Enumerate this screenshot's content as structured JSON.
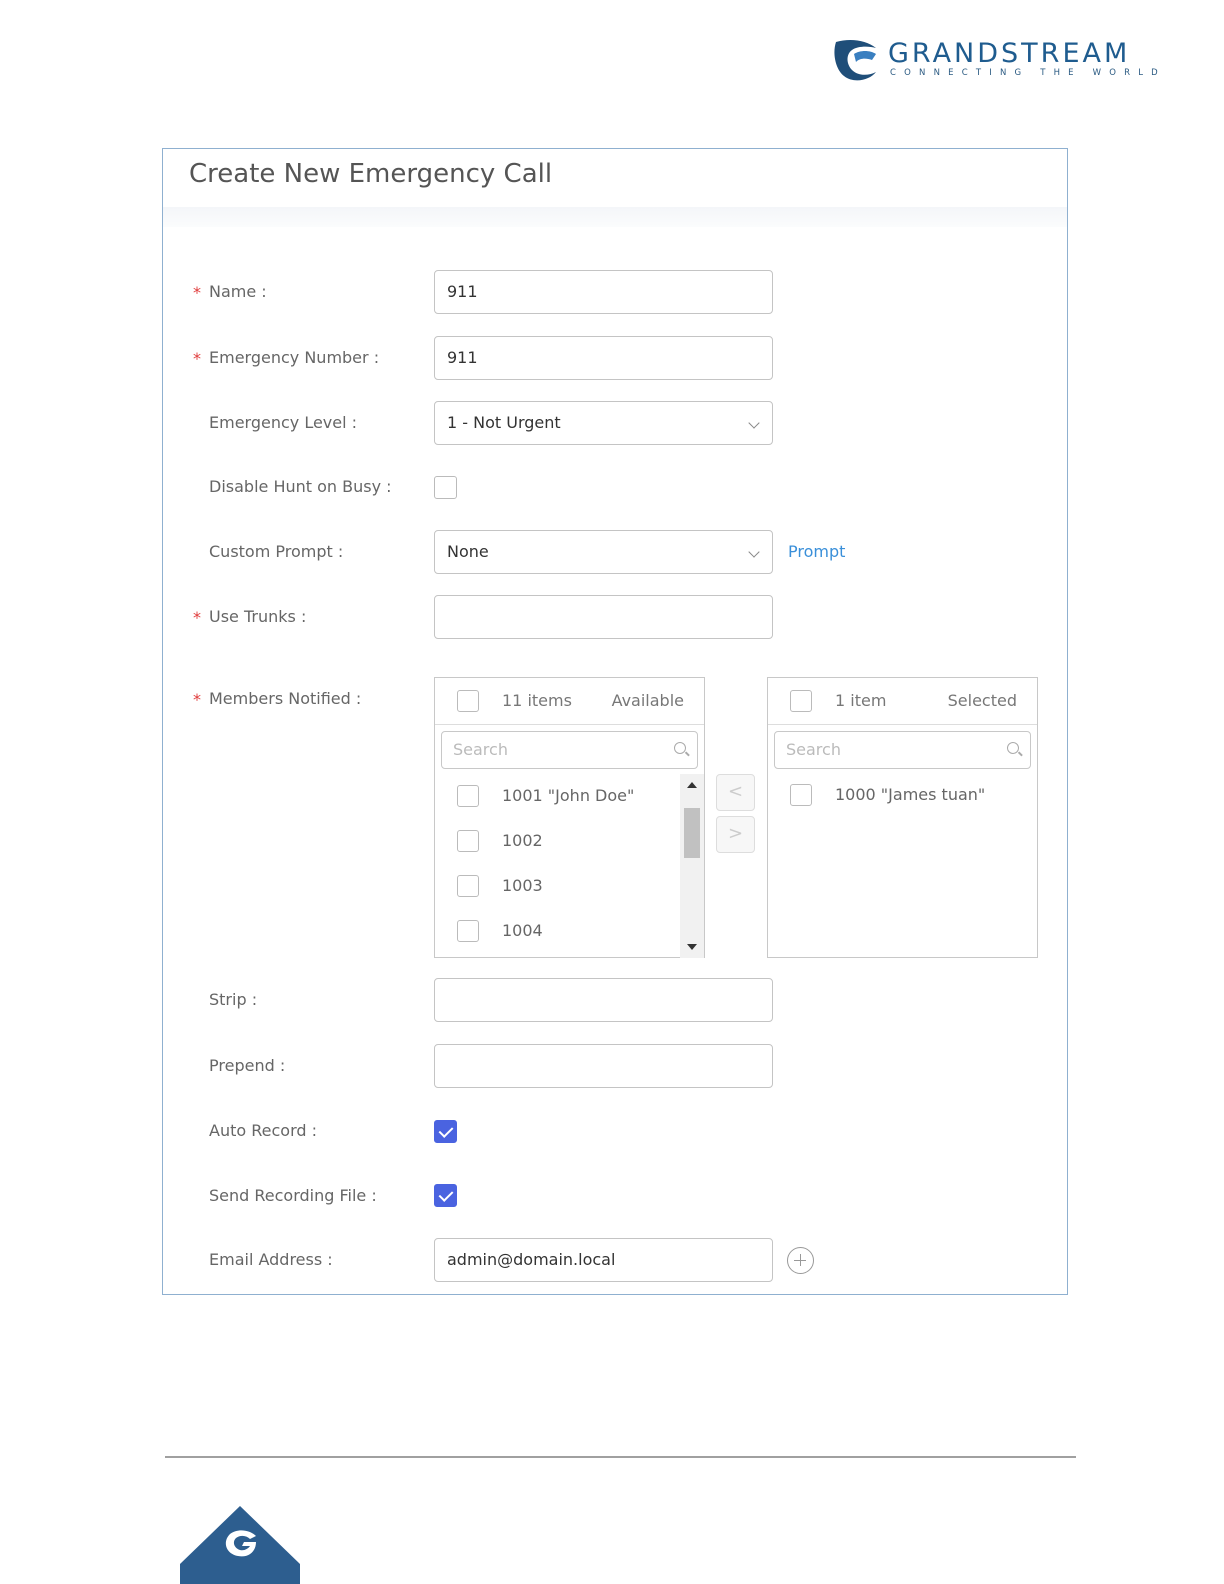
{
  "brand": {
    "name": "GRANDSTREAM",
    "tagline": "CONNECTING THE WORLD",
    "color": "#1f5c8f"
  },
  "panel": {
    "title": "Create New Emergency Call"
  },
  "form": {
    "name": {
      "label": "Name :",
      "value": "911",
      "required": true
    },
    "emergency_number": {
      "label": "Emergency Number :",
      "value": "911",
      "required": true
    },
    "emergency_level": {
      "label": "Emergency Level :",
      "value": "1 - Not Urgent"
    },
    "disable_hunt_on_busy": {
      "label": "Disable Hunt on Busy :",
      "checked": false
    },
    "custom_prompt": {
      "label": "Custom Prompt :",
      "value": "None",
      "link": "Prompt"
    },
    "use_trunks": {
      "label": "Use Trunks :",
      "value": "",
      "required": true
    },
    "members_notified": {
      "label": "Members Notified :",
      "required": true,
      "available": {
        "count": "11 items",
        "title": "Available",
        "search_placeholder": "Search",
        "items": [
          "1001 \"John Doe\"",
          "1002",
          "1003",
          "1004"
        ]
      },
      "selected": {
        "count": "1 item",
        "title": "Selected",
        "search_placeholder": "Search",
        "items": [
          "1000 \"James tuan\""
        ]
      },
      "move_left": "<",
      "move_right": ">"
    },
    "strip": {
      "label": "Strip :",
      "value": ""
    },
    "prepend": {
      "label": "Prepend :",
      "value": ""
    },
    "auto_record": {
      "label": "Auto Record :",
      "checked": true
    },
    "send_recording_file": {
      "label": "Send Recording File :",
      "checked": true
    },
    "email_address": {
      "label": "Email Address :",
      "value": "admin@domain.local"
    }
  },
  "colors": {
    "required": "#e03b3b",
    "checkbox_checked": "#4a63e0",
    "link": "#3a8fd9",
    "panel_border": "#8fb0d0"
  }
}
